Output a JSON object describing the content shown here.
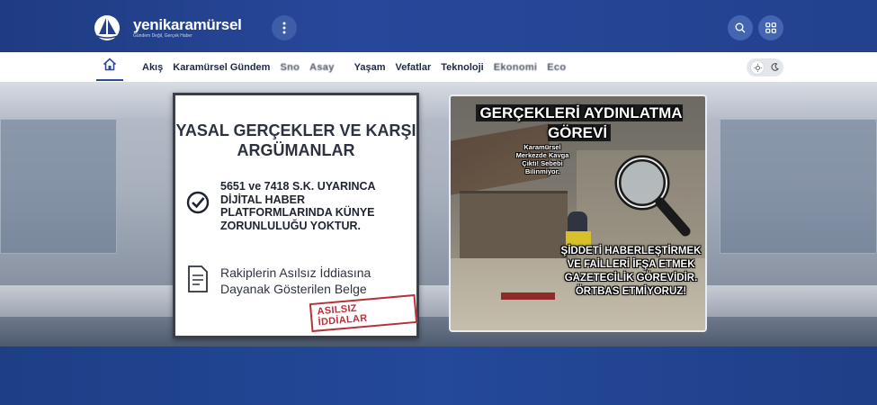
{
  "header": {
    "logo_name": "yenikaramürsel",
    "logo_slogan": "Gündem Değil, Gerçek Haber",
    "menu_icon": "more-vertical-icon",
    "search_icon": "search-icon",
    "apps_icon": "grid-icon"
  },
  "nav": {
    "home_icon": "home-icon",
    "items": [
      {
        "label": "Akış"
      },
      {
        "label": "Karamürsel Gündem"
      },
      {
        "label": "Sno"
      },
      {
        "label": "Asay"
      },
      {
        "label": "Yaşam"
      },
      {
        "label": "Vefatlar"
      },
      {
        "label": "Teknoloji"
      },
      {
        "label": "Ekonomi"
      },
      {
        "label": "Eco"
      }
    ],
    "theme_icons": [
      "sun-icon",
      "moon-icon"
    ]
  },
  "hero": {
    "left_panel": {
      "title": "YASAL GERÇEKLER VE KARŞI ARGÜMANLAR",
      "point1": "5651 ve 7418 S.K. UYARINCA DİJİTAL HABER PLATFORMLARINDA KÜNYE ZORUNLULUĞU YOKTUR.",
      "point2": "Rakiplerin Asılsız İddiasına Dayanak Gösterilen Belge",
      "stamp": "ASILSIZ İDDİALAR"
    },
    "right_panel": {
      "title": "GERÇEKLERİ AYDINLATMA GÖREVİ",
      "small_caption": "Karamürsel Merkezde Kavga Çıktı! Sebebi Bilinmiyor.",
      "bottom_text": "ŞİDDETİ HABERLEŞTİRMEK VE FAİLLERİ İFŞA ETMEK GAZETECİLİK GÖREVİDİR. ÖRTBAS ETMİYORUZ!"
    }
  },
  "colors": {
    "header_bg": "#22428f",
    "accent": "#2a4a9a",
    "stamp": "#b7313a"
  }
}
